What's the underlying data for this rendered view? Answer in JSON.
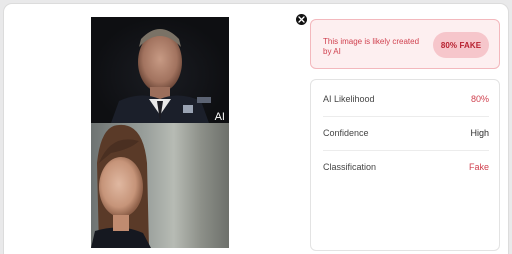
{
  "images": {
    "top_alt": "",
    "top_watermark": "AI"
  },
  "close_icon": "close-icon",
  "verdict": {
    "text": "This image is likely created by AI",
    "pill": "80% FAKE"
  },
  "details": {
    "rows": [
      {
        "label": "AI Likelihood",
        "value": "80%"
      },
      {
        "label": "Confidence",
        "value": "High"
      },
      {
        "label": "Classification",
        "value": "Fake"
      }
    ]
  },
  "colors": {
    "accent_red": "#d0414f",
    "pill_bg": "#f6c6cb",
    "verdict_bg": "#fdeff0"
  }
}
